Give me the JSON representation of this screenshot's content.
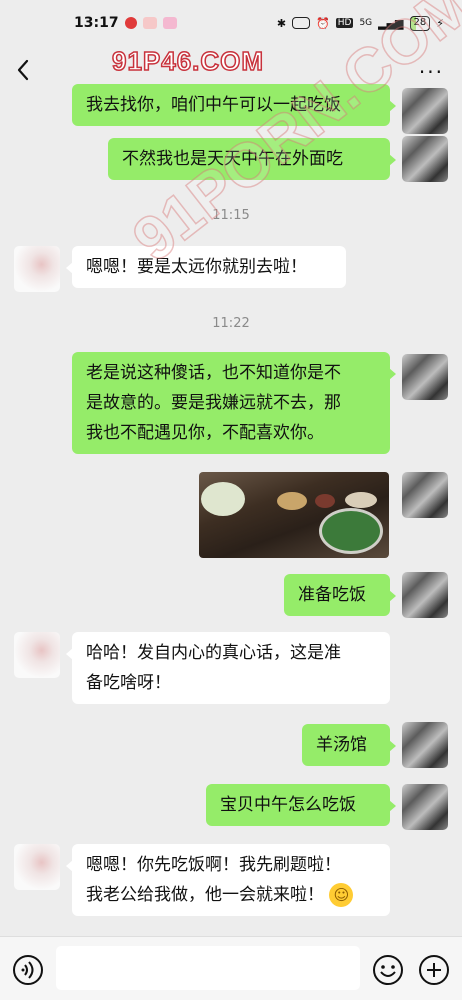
{
  "status_bar": {
    "time": "13:17",
    "network": "5G",
    "hd": "HD",
    "battery": "28"
  },
  "header": {
    "watermark": "91P46.COM",
    "more": "···"
  },
  "watermark_diagonal": "91PORN.COM",
  "messages": [
    {
      "side": "out",
      "text": "我去找你，咱们中午可以一起吃饭"
    },
    {
      "side": "out",
      "text": "不然我也是天天中午在外面吃"
    },
    {
      "type": "time",
      "text": "11:15"
    },
    {
      "side": "in",
      "text": "嗯嗯！要是太远你就别去啦！"
    },
    {
      "type": "time",
      "text": "11:22"
    },
    {
      "side": "out",
      "lines": [
        "老是说这种傻话，也不知道你是不",
        "是故意的。要是我嫌远就不去，那",
        "我也不配遇见你，不配喜欢你。"
      ]
    },
    {
      "side": "out",
      "type": "image",
      "alt": "photo"
    },
    {
      "side": "out",
      "text": "准备吃饭"
    },
    {
      "side": "in",
      "lines": [
        "哈哈！发自内心的真心话，这是准",
        "备吃啥呀！"
      ]
    },
    {
      "side": "out",
      "text": "羊汤馆"
    },
    {
      "side": "out",
      "text": "宝贝中午怎么吃饭"
    },
    {
      "side": "in",
      "lines": [
        "嗯嗯！你先吃饭啊！我先刷题啦！",
        "我老公给我做，他一会就来啦！"
      ]
    }
  ],
  "input_bar": {
    "placeholder": ""
  },
  "colors": {
    "out_bubble": "#95ec69",
    "in_bubble": "#ffffff",
    "background": "#ededed"
  }
}
